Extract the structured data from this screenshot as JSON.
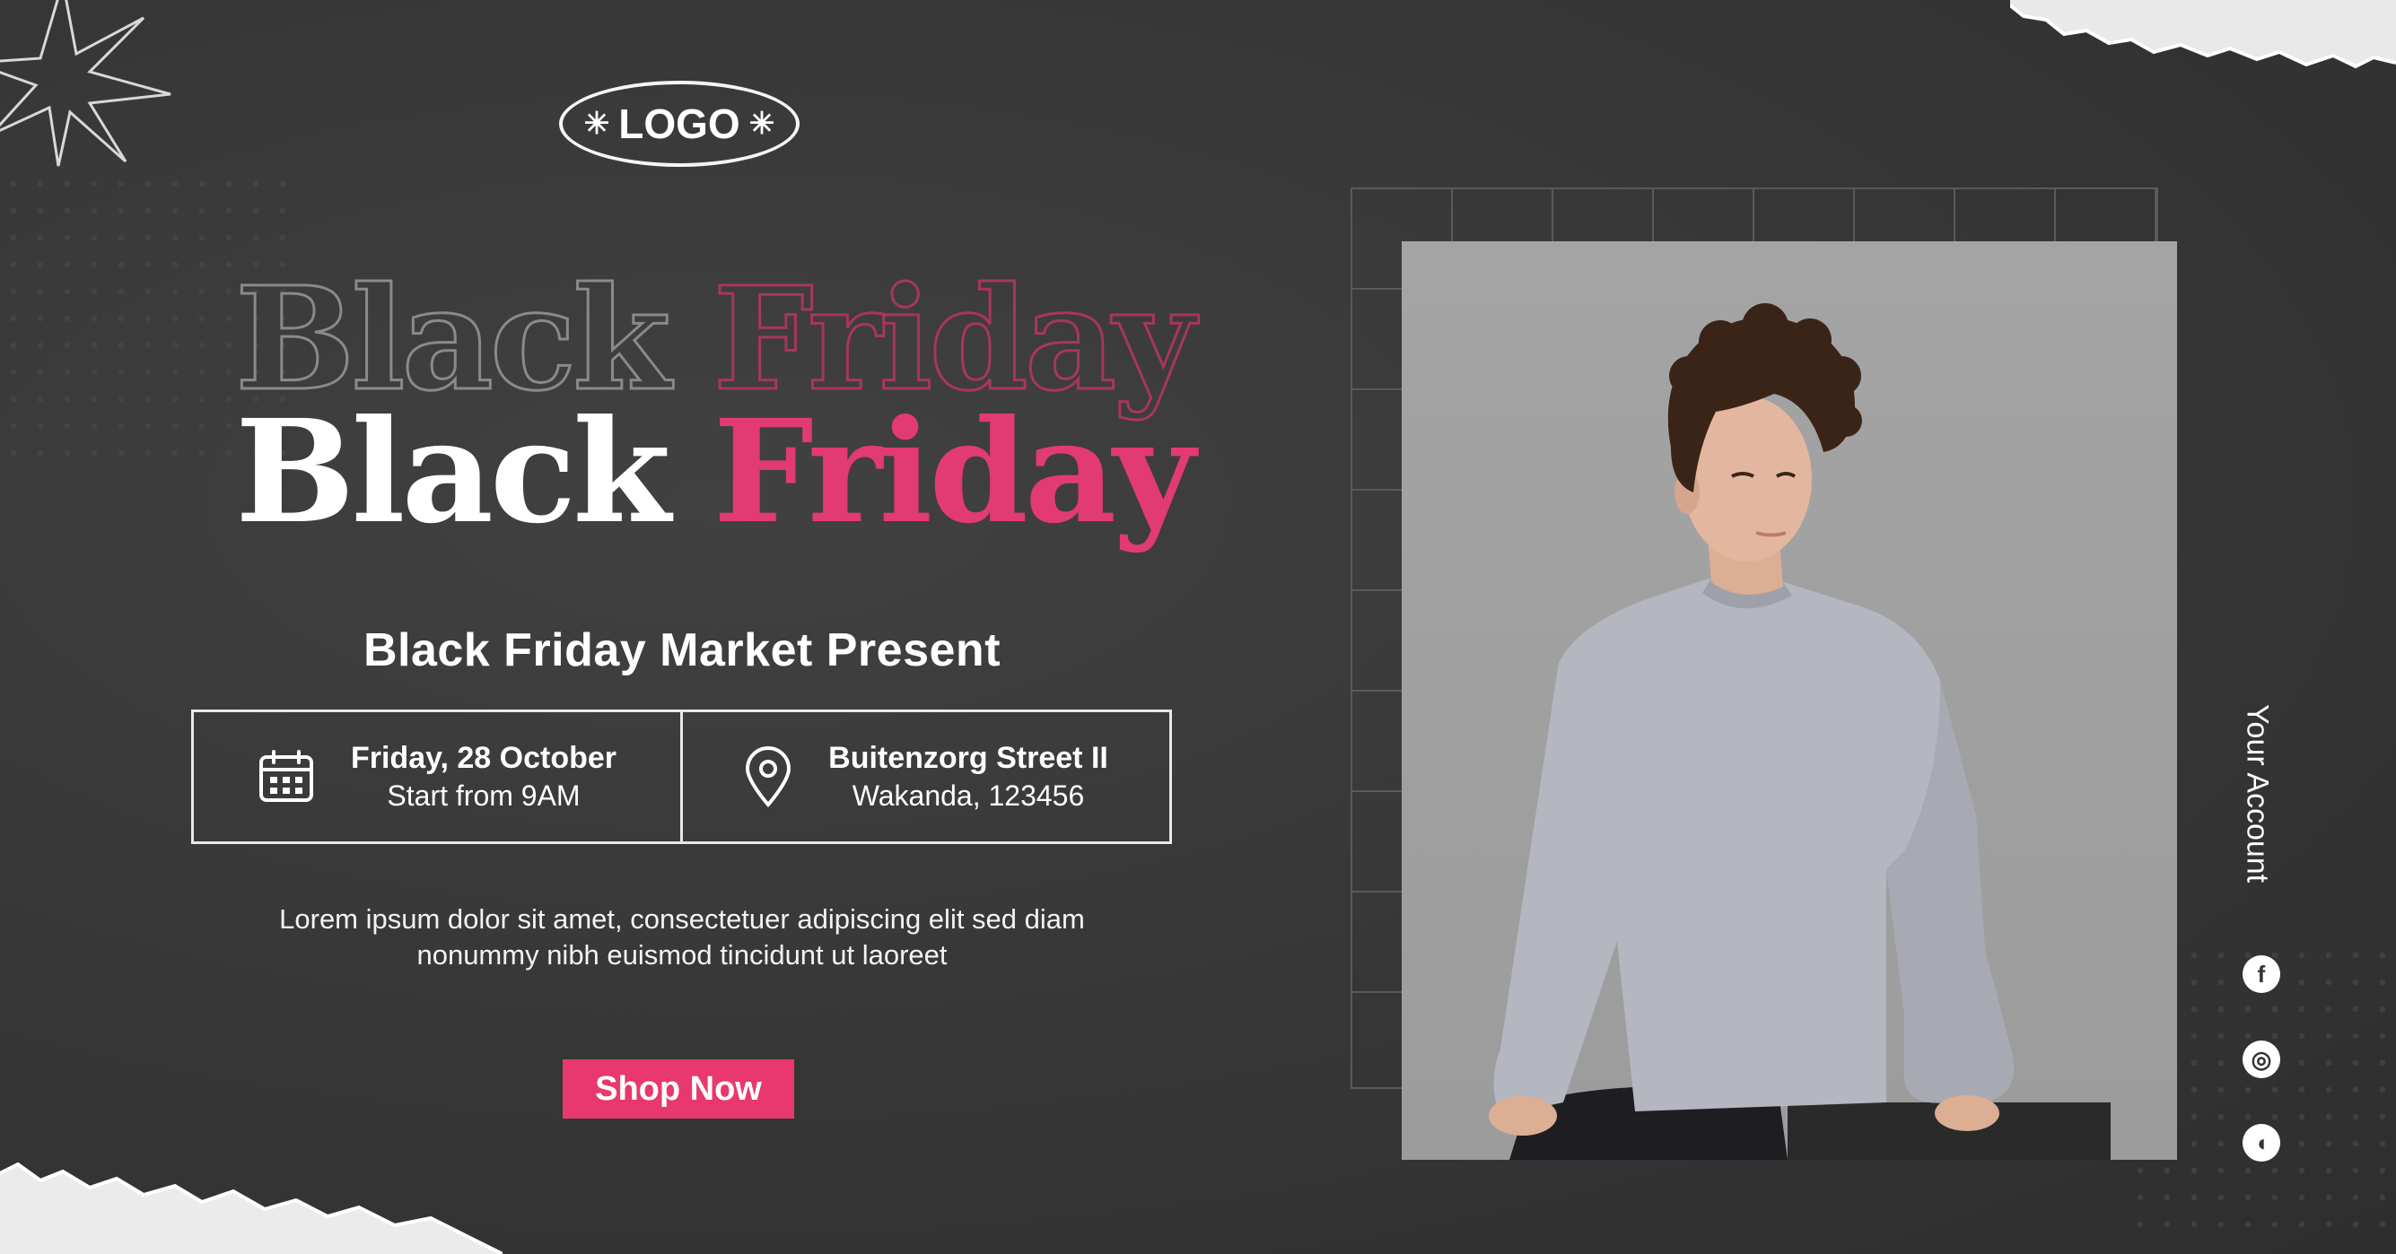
{
  "logo": {
    "text": "LOGO",
    "left_mark": "✳",
    "right_mark": "✳"
  },
  "headline": {
    "word1": "Black",
    "word2": "Friday"
  },
  "subtitle": "Black Friday Market Present",
  "event": {
    "date_line": "Friday, 28 October",
    "time_line": "Start from 9AM",
    "address_line": "Buitenzorg Street II",
    "city_line": "Wakanda, 123456",
    "date_icon": "calendar-icon",
    "location_icon": "location-pin-icon"
  },
  "body": {
    "line1": "Lorem ipsum dolor sit amet, consectetuer adipiscing elit sed diam",
    "line2": "nonummy nibh euismod tincidunt ut laoreet"
  },
  "cta": {
    "label": "Shop Now"
  },
  "sidebar": {
    "account_label": "Your Account",
    "social": [
      {
        "icon": "facebook-icon",
        "glyph": "f"
      },
      {
        "icon": "instagram-icon",
        "glyph": "◎"
      },
      {
        "icon": "chat-icon",
        "glyph": "◖"
      }
    ]
  },
  "colors": {
    "background": "#373737",
    "accent": "#e23a73",
    "button": "#e8386f",
    "text": "#ffffff"
  }
}
